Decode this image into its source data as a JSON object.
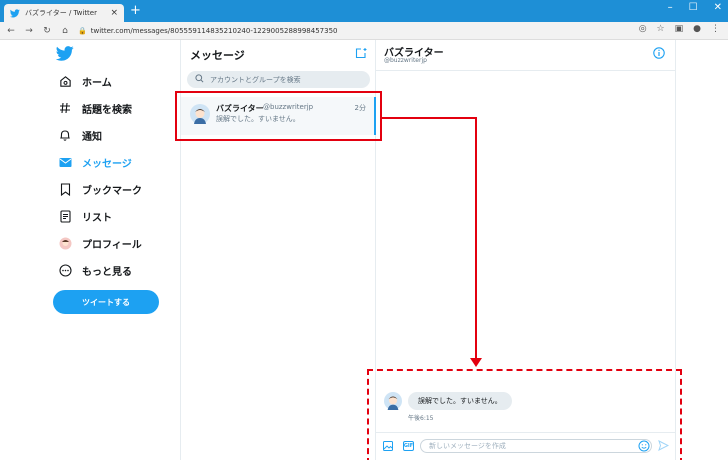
{
  "browser": {
    "tab_title": "バズライター / Twitter",
    "tab_close": "×",
    "new_tab": "+",
    "url": "twitter.com/messages/805559114835210240-1229005288998457350",
    "window_controls": [
      "–",
      "☐",
      "✕"
    ]
  },
  "sidebar": {
    "items": [
      {
        "label": "ホーム",
        "icon": "home-icon"
      },
      {
        "label": "話題を検索",
        "icon": "hashtag-icon"
      },
      {
        "label": "通知",
        "icon": "bell-icon"
      },
      {
        "label": "メッセージ",
        "icon": "mail-icon",
        "active": true
      },
      {
        "label": "ブックマーク",
        "icon": "bookmark-icon"
      },
      {
        "label": "リスト",
        "icon": "list-icon"
      },
      {
        "label": "プロフィール",
        "icon": "avatar-icon"
      },
      {
        "label": "もっと見る",
        "icon": "more-icon"
      }
    ],
    "tweet_button": "ツイートする"
  },
  "messages": {
    "title": "メッセージ",
    "search_placeholder": "アカウントとグループを検索",
    "conversation": {
      "name": "バズライター",
      "handle": "@buzzwriterjp",
      "time": "2分",
      "preview": "誤解でした。すいません。"
    }
  },
  "chat": {
    "name": "バズライター",
    "handle": "@buzzwriterjp",
    "message": "誤解でした。すいません。",
    "message_time": "午後6:15",
    "composer_placeholder": "新しいメッセージを作成",
    "gif_label": "GIF"
  },
  "colors": {
    "accent": "#1da1f2",
    "annotation": "#e3000f",
    "titlebar": "#1e8fd6"
  }
}
